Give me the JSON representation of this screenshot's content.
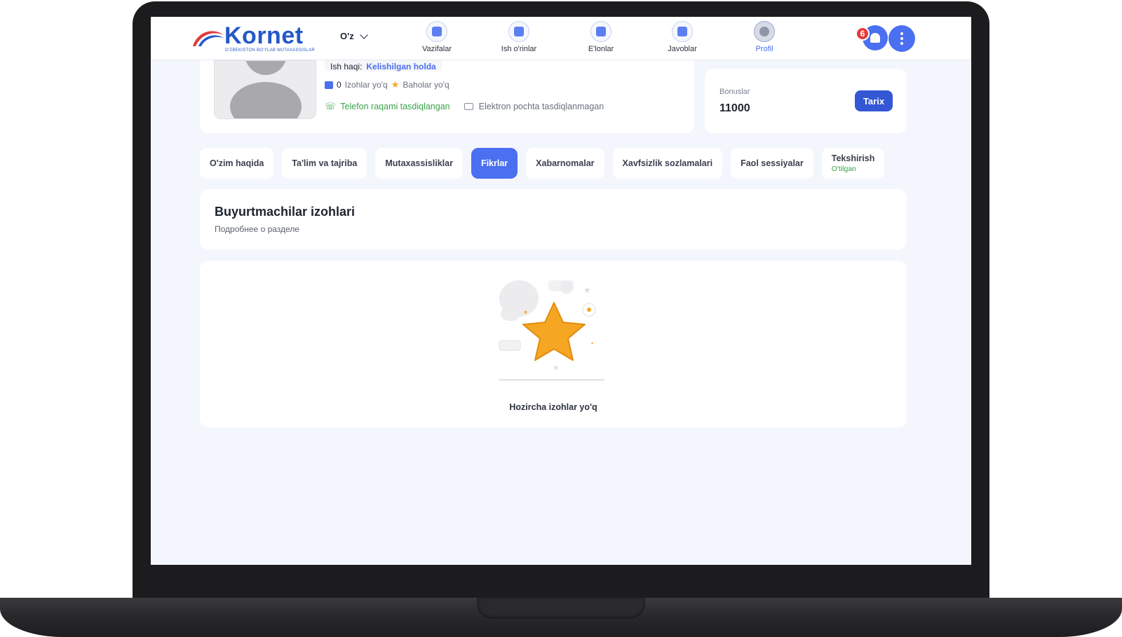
{
  "brand": {
    "name": "Kornet",
    "tagline": "O'ZBEKISTON BO'YLAB MUTAXASSISLAR",
    "color": "#2458c8"
  },
  "header": {
    "language": "O'z",
    "nav": [
      {
        "label": "Vazifalar",
        "icon": "tasks-icon"
      },
      {
        "label": "Ish o'rinlar",
        "icon": "jobs-icon"
      },
      {
        "label": "E'lonlar",
        "icon": "ads-icon"
      },
      {
        "label": "Javoblar",
        "icon": "replies-icon"
      },
      {
        "label": "Profil",
        "icon": "profile-icon",
        "active": true
      }
    ],
    "notifications_count": "6"
  },
  "profile": {
    "salary_label": "Ish haqi:",
    "salary_value": "Kelishilgan holda",
    "reviews_count": "0",
    "reviews_text": "Izohlar yo'q",
    "ratings_text": "Baholar yo'q",
    "phone_status": "Telefon raqami tasdiqlangan",
    "email_status": "Elektron pochta tasdiqlanmagan"
  },
  "bonus": {
    "label": "Bonuslar",
    "value": "11000",
    "history_button": "Tarix"
  },
  "tabs": [
    {
      "label": "O'zim haqida"
    },
    {
      "label": "Ta'lim va tajriba"
    },
    {
      "label": "Mutaxassisliklar"
    },
    {
      "label": "Fikrlar",
      "active": true
    },
    {
      "label": "Xabarnomalar"
    },
    {
      "label": "Xavfsizlik sozlamalari"
    },
    {
      "label": "Faol sessiyalar"
    },
    {
      "label": "Tekshirish",
      "sub": "O'tilgan"
    }
  ],
  "section": {
    "title": "Buyurtmachilar izohlari",
    "subtitle": "Подробнее о разделе"
  },
  "empty_state": {
    "text": "Hozircha izohlar yo'q"
  },
  "colors": {
    "accent": "#4a6ff0",
    "success": "#3aa34a",
    "badge": "#e53a3a",
    "star": "#f5a623"
  }
}
